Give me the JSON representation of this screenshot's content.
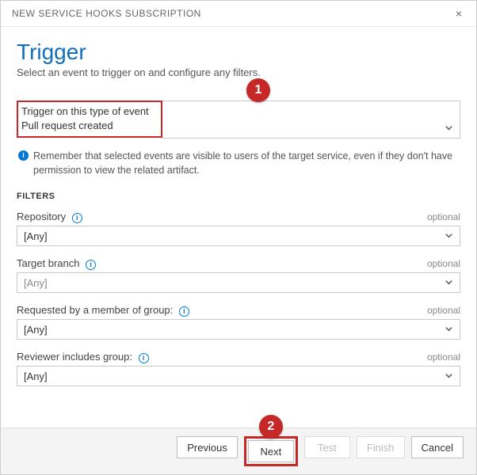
{
  "header": {
    "title": "NEW SERVICE HOOKS SUBSCRIPTION",
    "close_label": "×"
  },
  "main": {
    "title": "Trigger",
    "subtitle": "Select an event to trigger on and configure any filters."
  },
  "callouts": {
    "badge1": "1",
    "badge2": "2"
  },
  "event_field": {
    "label": "Trigger on this type of event",
    "value": "Pull request created"
  },
  "info_note": "Remember that selected events are visible to users of the target service, even if they don't have permission to view the related artifact.",
  "filters_heading": "FILTERS",
  "optional_text": "optional",
  "filters": {
    "repository": {
      "label": "Repository",
      "value": "[Any]"
    },
    "target_branch": {
      "label": "Target branch",
      "value": "[Any]"
    },
    "requested_by": {
      "label": "Requested by a member of group:",
      "value": "[Any]"
    },
    "reviewer": {
      "label": "Reviewer includes group:",
      "value": "[Any]"
    }
  },
  "buttons": {
    "previous": "Previous",
    "next": "Next",
    "test": "Test",
    "finish": "Finish",
    "cancel": "Cancel"
  }
}
